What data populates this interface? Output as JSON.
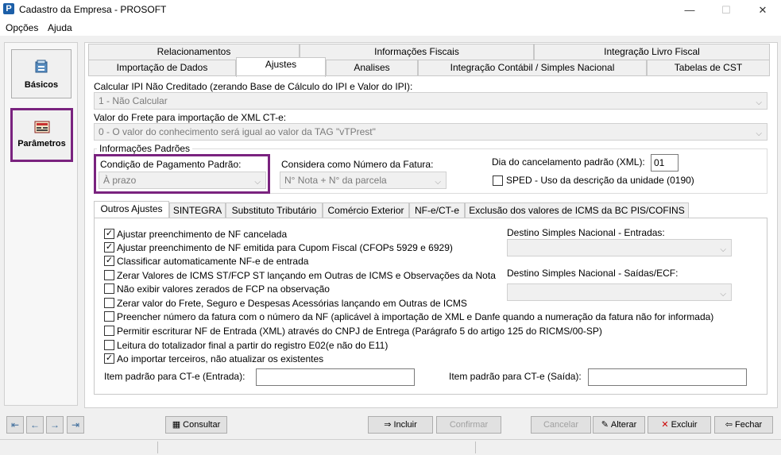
{
  "window": {
    "title": "Cadastro da Empresa - PROSOFT",
    "minimize": "—",
    "maximize": "☐",
    "close": "✕"
  },
  "menu": {
    "options": "Opções",
    "help": "Ajuda"
  },
  "sidebar": {
    "items": [
      {
        "label": "Básicos"
      },
      {
        "label": "Parâmetros"
      }
    ]
  },
  "tabs_row1": [
    "Relacionamentos",
    "Informações Fiscais",
    "Integração Livro Fiscal"
  ],
  "tabs_row2": [
    "Importação de Dados",
    "Ajustes",
    "Analises",
    "Integração Contábil / Simples Nacional",
    "Tabelas de CST"
  ],
  "form": {
    "ipi_label": "Calcular IPI Não Creditado (zerando Base de Cálculo do IPI e Valor do IPI):",
    "ipi_value": "1 - Não Calcular",
    "frete_label": "Valor do Frete para importação de XML CT-e:",
    "frete_value": "0 - O valor do conhecimento será igual ao valor da TAG \"vTPrest\"",
    "info_title": "Informações Padrões",
    "cond_label": "Condição de Pagamento Padrão:",
    "cond_value": "À prazo",
    "fatura_label": "Considera como Número da Fatura:",
    "fatura_value": "N° Nota + N° da parcela",
    "dia_label": "Dia do cancelamento padrão (XML):",
    "dia_value": "01",
    "sped_label": "SPED - Uso da descrição da unidade (0190)"
  },
  "subtabs": [
    "Outros Ajustes",
    "SINTEGRA",
    "Substituto Tributário",
    "Comércio Exterior",
    "NF-e/CT-e",
    "Exclusão dos valores de ICMS da BC PIS/COFINS"
  ],
  "checks": [
    {
      "label": "Ajustar preenchimento de NF cancelada",
      "checked": "✓"
    },
    {
      "label": "Ajustar preenchimento de NF emitida para Cupom Fiscal (CFOPs 5929 e 6929)",
      "checked": "✓"
    },
    {
      "label": "Classificar automaticamente NF-e de entrada",
      "checked": "✓"
    },
    {
      "label": "Zerar Valores de ICMS ST/FCP ST lançando em Outras de ICMS e Observações da Nota",
      "checked": ""
    },
    {
      "label": "Não exibir valores zerados de FCP na observação",
      "checked": ""
    },
    {
      "label": "Zerar valor do Frete, Seguro e Despesas Acessórias lançando em Outras de ICMS",
      "checked": ""
    },
    {
      "label": "Preencher número da fatura com o número da NF (aplicável à importação de XML e Danfe quando a numeração da fatura não for informada)",
      "checked": ""
    },
    {
      "label": "Permitir escriturar NF de Entrada (XML) através do CNPJ de Entrega (Parágrafo 5 do artigo 125 do RICMS/00-SP)",
      "checked": ""
    },
    {
      "label": "Leitura do totalizador final a partir do registro E02(e não do E11)",
      "checked": ""
    },
    {
      "label": "Ao importar terceiros, não atualizar os existentes",
      "checked": "✓"
    }
  ],
  "destino": {
    "entradas_label": "Destino Simples Nacional - Entradas:",
    "saidas_label": "Destino Simples Nacional - Saídas/ECF:"
  },
  "cte": {
    "entrada_label": "Item padrão para CT-e (Entrada):",
    "saida_label": "Item padrão para CT-e (Saída):"
  },
  "buttons": {
    "consultar": "Consultar",
    "incluir": "Incluir",
    "confirmar": "Confirmar",
    "cancelar": "Cancelar",
    "alterar": "Alterar",
    "excluir": "Excluir",
    "fechar": "Fechar"
  },
  "nav_arrows": [
    "⇤",
    "←",
    "→",
    "⇥"
  ]
}
